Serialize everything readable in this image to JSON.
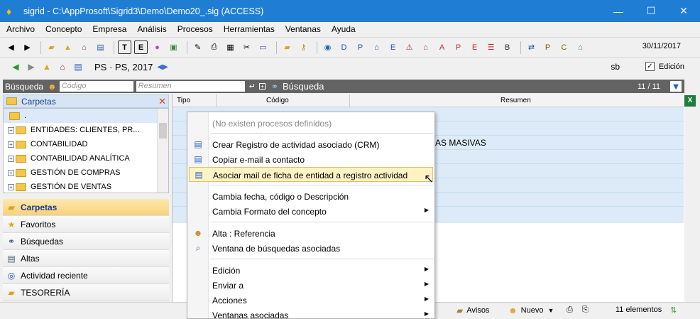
{
  "window": {
    "title": "sigrid - C:\\AppProsoft\\Sigrid3\\Demo\\Demo20_.sig (ACCESS)"
  },
  "menubar": [
    "Archivo",
    "Concepto",
    "Empresa",
    "Análisis",
    "Procesos",
    "Herramientas",
    "Ventanas",
    "Ayuda"
  ],
  "toolbar": {
    "date": "30/11/2017"
  },
  "navbar": {
    "context": "PS · PS, 2017",
    "user": "sb",
    "edicion_label": "Edición",
    "edicion_checked": true
  },
  "search": {
    "label": "Búsqueda",
    "codigo_placeholder": "Código",
    "resumen_placeholder": "Resumen",
    "busqueda_label": "Búsqueda",
    "count": "11 / 11"
  },
  "leftpanel": {
    "header": "Carpetas",
    "tree": [
      ".",
      "ENTIDADES: CLIENTES, PR...",
      "CONTABILIDAD",
      "CONTABILIDAD ANALÍTICA",
      "GESTIÓN DE COMPRAS",
      "GESTIÓN DE VENTAS"
    ],
    "sections": [
      "Carpetas",
      "Favoritos",
      "Búsquedas",
      "Altas",
      "Actividad reciente",
      "TESORERÍA"
    ]
  },
  "grid": {
    "columns": [
      "Tipo",
      "Código",
      "Resumen"
    ],
    "visible_text": "AS MASIVAS"
  },
  "statusbar": {
    "avisos": "Avisos",
    "nuevo": "Nuevo",
    "count": "11 elementos"
  },
  "context_menu": {
    "no_processes": "(No existen procesos definidos)",
    "crear": "Crear Registro de actividad asociado (CRM)",
    "copiar": "Copiar e-mail a contacto",
    "asociar": "Asociar mail de ficha de entidad a registro actividad",
    "cambia_fecha": "Cambia fecha, código o Descripción",
    "cambia_formato": "Cambia Formato del concepto",
    "alta": "Alta : Referencia",
    "ventana_busquedas": "Ventana de búsquedas asociadas",
    "edicion": "Edición",
    "enviar": "Enviar a",
    "acciones": "Acciones",
    "ventanas": "Ventanas asociadas"
  }
}
